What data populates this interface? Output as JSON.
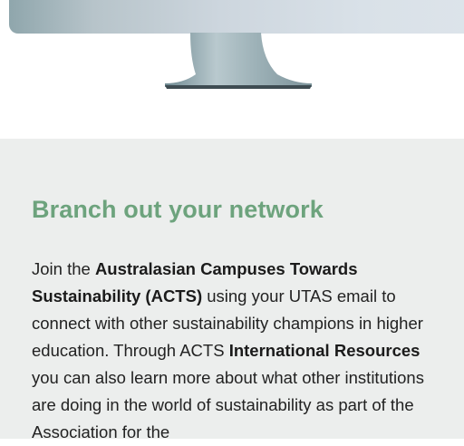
{
  "hero": {
    "illustration": "desktop-monitor-icon"
  },
  "section": {
    "heading": "Branch out your network",
    "paragraph": {
      "t1": "Join the ",
      "b1": "Australasian Campuses Towards Sustainability (ACTS)",
      "t2": " using your UTAS email to connect with other sustainability champions in higher education. Through ACTS ",
      "b2": "International Resources",
      "t3": " you can also learn more about what other institutions are doing in the world of sustainability as part of the Association for the"
    }
  },
  "colors": {
    "heading": "#6da37d",
    "section_background": "#eceeed",
    "body_text": "#222222"
  }
}
